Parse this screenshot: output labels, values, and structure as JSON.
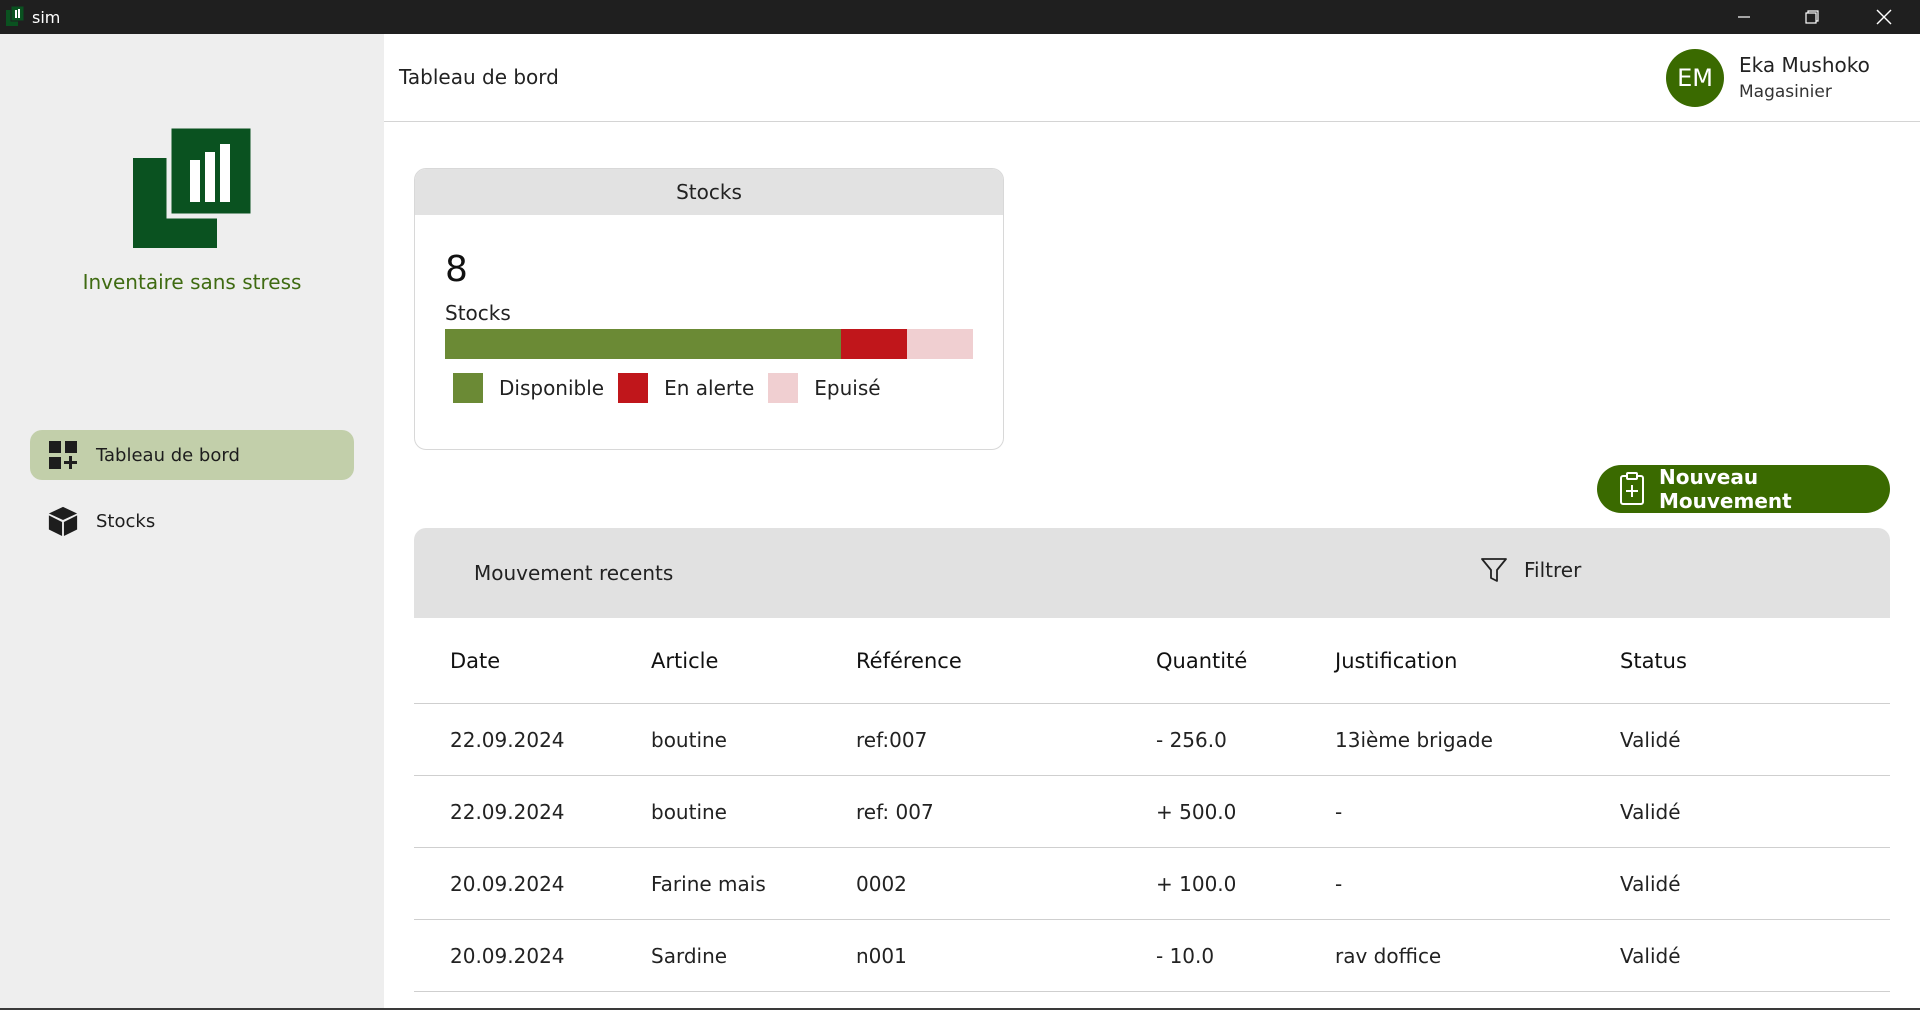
{
  "window": {
    "title": "sim"
  },
  "sidebar": {
    "brand": "Inventaire sans stress",
    "items": [
      {
        "label": "Tableau de bord",
        "icon": "dashboard-add-icon",
        "active": true
      },
      {
        "label": "Stocks",
        "icon": "box-icon",
        "active": false
      }
    ]
  },
  "header": {
    "title": "Tableau de bord",
    "user": {
      "initials": "EM",
      "name": "Eka Mushoko",
      "role": "Magasinier"
    }
  },
  "stocks_card": {
    "title": "Stocks",
    "value": "8",
    "label": "Stocks",
    "distribution": [
      {
        "name": "Disponible",
        "fraction": 0.75,
        "color": "#6b8a35"
      },
      {
        "name": "En alerte",
        "fraction": 0.125,
        "color": "#c0161b"
      },
      {
        "name": "Epuisé",
        "fraction": 0.125,
        "color": "#f0cfd1"
      }
    ]
  },
  "new_movement_button": {
    "label": "Nouveau Mouvement",
    "icon": "clipboard-plus-icon"
  },
  "movements": {
    "title": "Mouvement recents",
    "filter_label": "Filtrer",
    "columns": [
      "Date",
      "Article",
      "Référence",
      "Quantité",
      "Justification",
      "Status"
    ],
    "rows": [
      [
        "22.09.2024",
        "boutine",
        "ref:007",
        "- 256.0",
        "13ième brigade",
        "Validé"
      ],
      [
        "22.09.2024",
        "boutine",
        "ref: 007",
        "+ 500.0",
        "-",
        "Validé"
      ],
      [
        "20.09.2024",
        "Farine mais",
        "0002",
        "+ 100.0",
        "-",
        "Validé"
      ],
      [
        "20.09.2024",
        "Sardine",
        "n001",
        "- 10.0",
        "rav doffice",
        "Validé"
      ]
    ]
  },
  "colors": {
    "brand_green": "#3a6a00",
    "logo_green": "#0a5220",
    "active_nav": "#c2cfaa"
  }
}
